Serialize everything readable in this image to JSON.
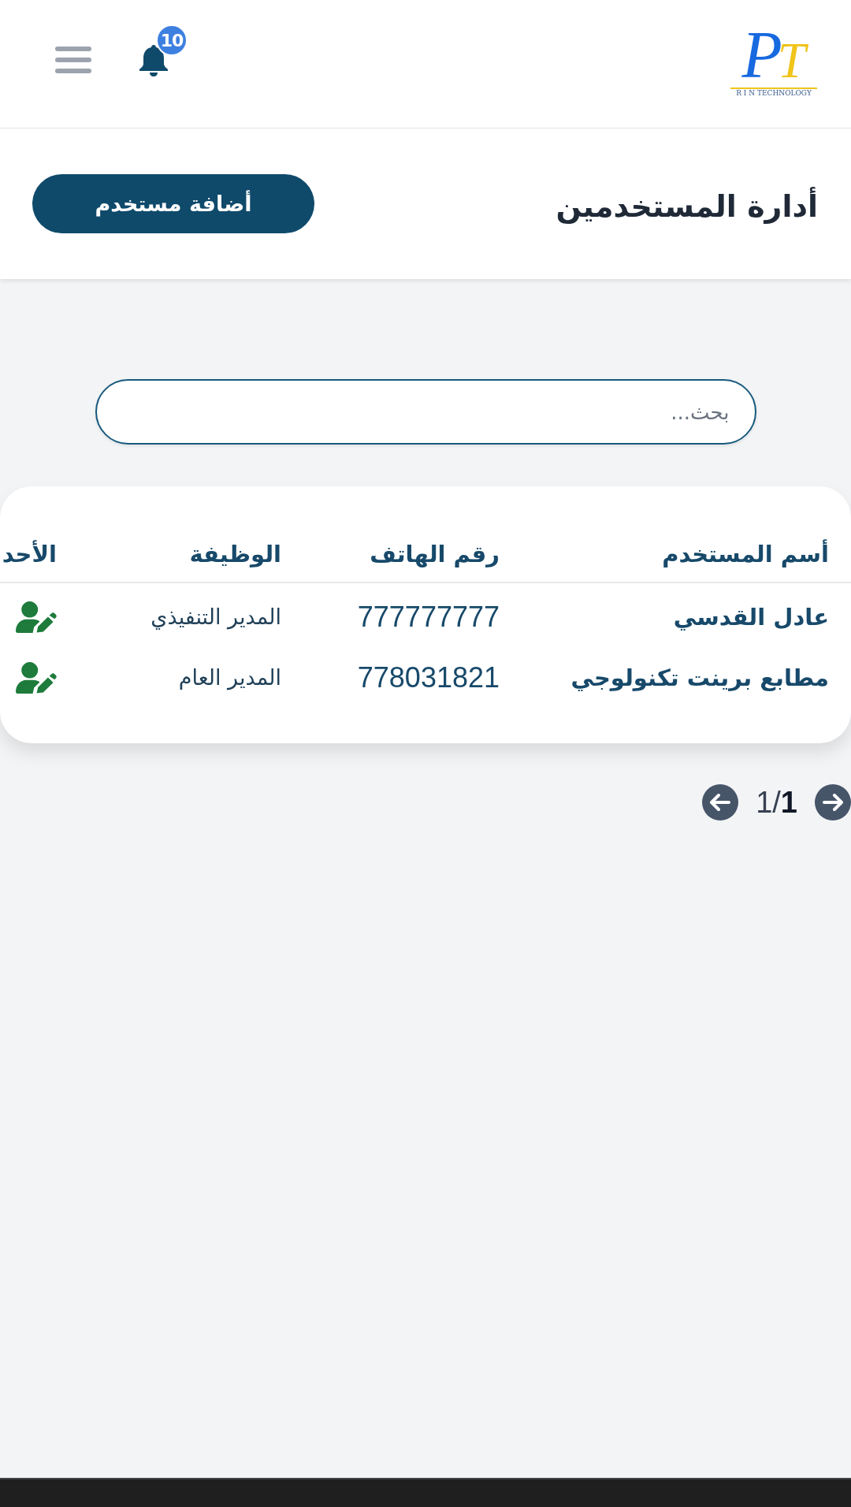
{
  "header": {
    "notifications": {
      "count": "10"
    },
    "logo": {
      "mark": "PT",
      "tagline": "R I N TECHNOLOGY"
    }
  },
  "page": {
    "title": "أدارة المستخدمين",
    "add_button": "أضافة مستخدم"
  },
  "search": {
    "placeholder": "بحث..."
  },
  "table": {
    "columns": [
      "أسم المستخدم",
      "رقم الهاتف",
      "الوظيفة",
      "الأحد"
    ],
    "rows": [
      {
        "name": "عادل القدسي",
        "phone": "777777777",
        "job": "المدير التنفيذي"
      },
      {
        "name": "مطابع برينت تكنولوجي",
        "phone": "778031821",
        "job": "المدير العام"
      }
    ]
  },
  "pagination": {
    "indicator": "1/**1**"
  }
}
